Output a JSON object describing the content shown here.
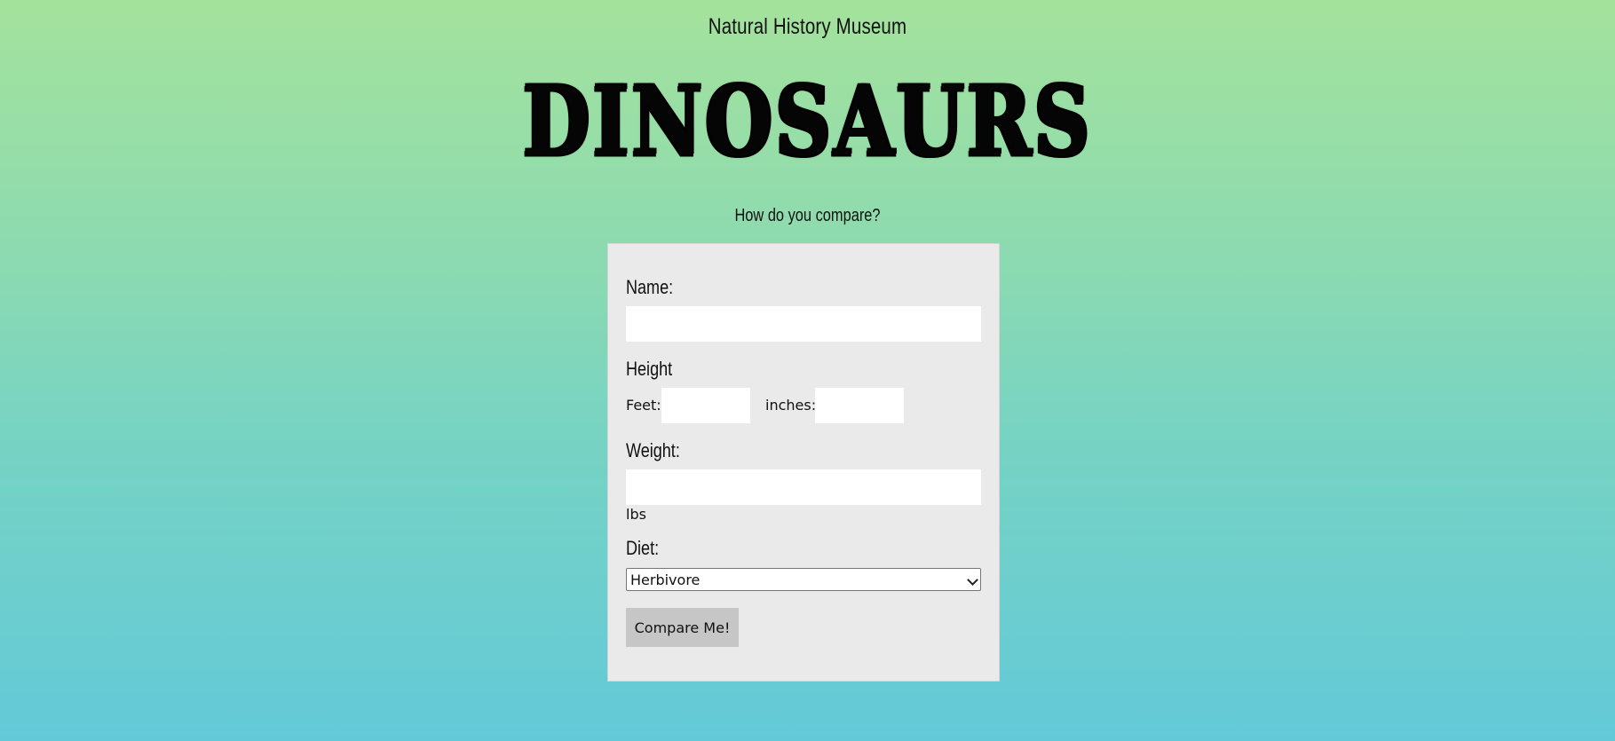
{
  "header": {
    "museum_name": "Natural History Museum",
    "hero_title": "Dinosaurs",
    "subtitle": "How do you compare?"
  },
  "form": {
    "name_label": "Name:",
    "name_value": "",
    "height_label": "Height",
    "feet_label": "Feet:",
    "feet_value": "",
    "inches_label": "inches:",
    "inches_value": "",
    "weight_label": "Weight:",
    "weight_value": "",
    "weight_unit": "lbs",
    "diet_label": "Diet:",
    "diet_selected": "Herbivore",
    "compare_button": "Compare Me!"
  },
  "colors": {
    "gradient_top": "#a4e29c",
    "gradient_bottom": "#63c9d8",
    "card_background": "#eaeaea",
    "button_background": "#c6c6c6"
  }
}
